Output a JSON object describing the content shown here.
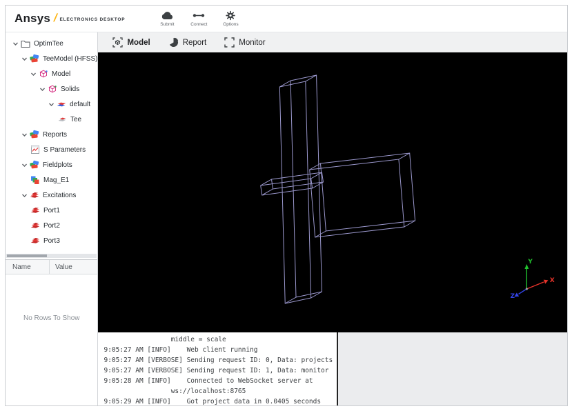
{
  "header": {
    "logo": {
      "brand": "Ansys",
      "product": "ELECTRONICS DESKTOP"
    },
    "toolbar": [
      {
        "label": "Submit",
        "icon": "cloud-icon"
      },
      {
        "label": "Connect",
        "icon": "connect-icon"
      },
      {
        "label": "Options",
        "icon": "gear-icon"
      }
    ]
  },
  "sidebar": {
    "tree": [
      {
        "label": "OptimTee",
        "icon": "folder-icon",
        "level": 0,
        "expanded": true
      },
      {
        "label": "TeeModel (HFSS)",
        "icon": "design-icon",
        "level": 1,
        "expanded": true
      },
      {
        "label": "Model",
        "icon": "model-icon",
        "level": 2,
        "expanded": true
      },
      {
        "label": "Solids",
        "icon": "solids-icon",
        "level": 3,
        "expanded": true
      },
      {
        "label": "default",
        "icon": "material-icon",
        "level": 4,
        "expanded": true
      },
      {
        "label": "Tee",
        "icon": "part-icon",
        "level": 5,
        "expanded": null
      },
      {
        "label": "Reports",
        "icon": "design-icon",
        "level": 1,
        "expanded": true
      },
      {
        "label": "S Parameters",
        "icon": "sparams-icon",
        "level": 2,
        "expanded": null
      },
      {
        "label": "Fieldplots",
        "icon": "design-icon",
        "level": 1,
        "expanded": true
      },
      {
        "label": "Mag_E1",
        "icon": "fieldplot-icon",
        "level": 2,
        "expanded": null
      },
      {
        "label": "Excitations",
        "icon": "excitations-icon",
        "level": 1,
        "expanded": true
      },
      {
        "label": "Port1",
        "icon": "port-icon",
        "level": 2,
        "expanded": null
      },
      {
        "label": "Port2",
        "icon": "port-icon",
        "level": 2,
        "expanded": null
      },
      {
        "label": "Port3",
        "icon": "port-icon",
        "level": 2,
        "expanded": null
      }
    ],
    "properties": {
      "columns": [
        "Name",
        "Value"
      ],
      "empty_text": "No Rows To Show"
    }
  },
  "main": {
    "tabs": [
      {
        "label": "Model",
        "icon": "model-tab-icon",
        "active": true
      },
      {
        "label": "Report",
        "icon": "report-tab-icon",
        "active": false
      },
      {
        "label": "Monitor",
        "icon": "monitor-tab-icon",
        "active": false
      }
    ],
    "viewport": {
      "background": "#000000",
      "wireframe_color": "#a6a3dc",
      "axes": {
        "x": {
          "label": "X",
          "color": "#e8332a"
        },
        "y": {
          "label": "Y",
          "color": "#21c12e"
        },
        "z": {
          "label": "Z",
          "color": "#3344e8"
        }
      }
    }
  },
  "console": {
    "lines": [
      "                 middle = scale",
      "9:05:27 AM [INFO]    Web client running",
      "9:05:27 AM [VERBOSE] Sending request ID: 0, Data: projects",
      "9:05:27 AM [VERBOSE] Sending request ID: 1, Data: monitor",
      "9:05:28 AM [INFO]    Connected to WebSocket server at",
      "                 ws://localhost:8765",
      "9:05:29 AM [INFO]    Got project data in 0.0405 seconds"
    ]
  }
}
